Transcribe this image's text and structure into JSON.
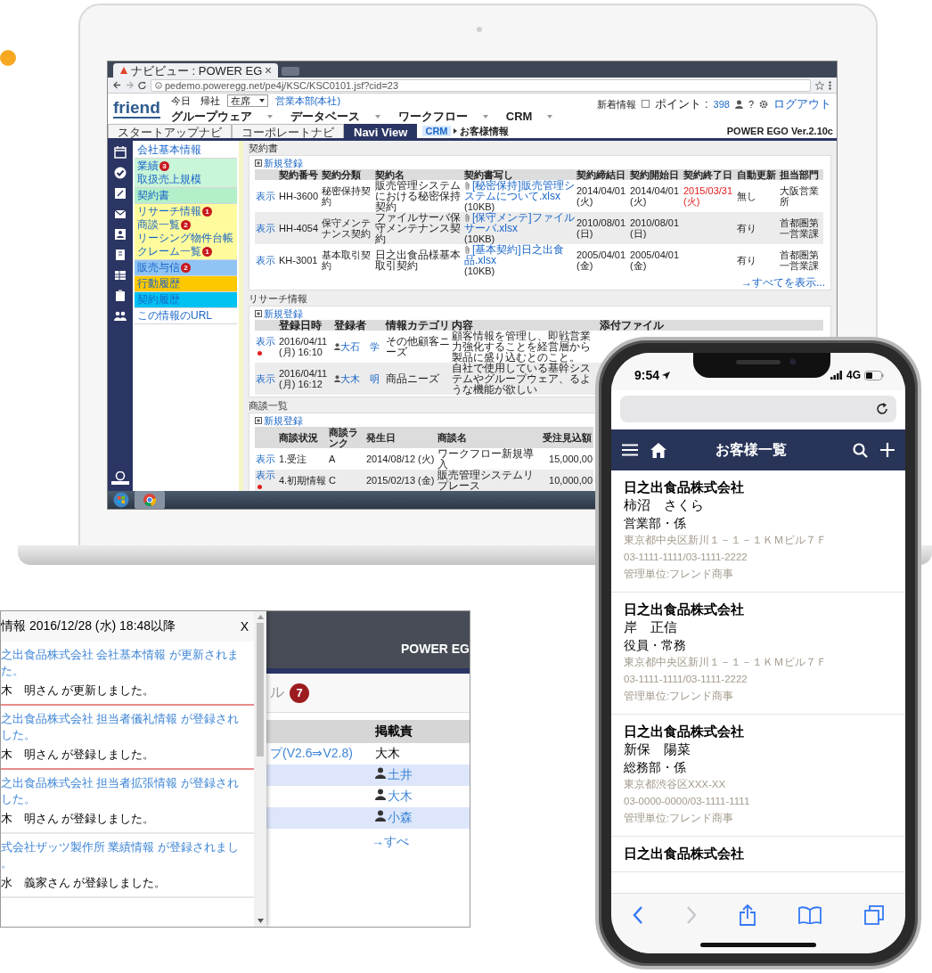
{
  "laptop": {
    "browser_tab": {
      "label": "ナビビュー : POWER EG"
    },
    "url": "pedemo.poweregg.net/pe4j/KSC/KSC0101.jsf?cid=23",
    "app_header": {
      "logo": "friend",
      "presence_label": "今日　帰社",
      "presence_select": "在席",
      "department": "営業本部(本社)",
      "menus": [
        "グループウェア",
        "データベース",
        "ワークフロー",
        "CRM"
      ],
      "news": "新着情報",
      "news_checked": false,
      "points_label": "ポイント :",
      "points": "398",
      "help": "?",
      "logout": "ログアウト"
    },
    "nav_tabs": [
      {
        "label": "スタートアップナビ",
        "selected": false
      },
      {
        "label": "コーポレートナビ",
        "selected": false
      },
      {
        "label": "Navi View",
        "selected": true
      }
    ],
    "breadcrumb": {
      "root": "CRM",
      "current": "お客様情報"
    },
    "version": "POWER EGO Ver.2.10c",
    "side_menu": [
      {
        "color": "#ffffff",
        "items": [
          {
            "label": "会社基本情報"
          }
        ]
      },
      {
        "color": "#c9f5d8",
        "items": [
          {
            "label": "業績",
            "badge": "3"
          },
          {
            "label": "取扱売上規模"
          }
        ]
      },
      {
        "color": "#b3efc9",
        "items": [
          {
            "label": "契約書"
          }
        ]
      },
      {
        "color": "#fdfb9c",
        "items": [
          {
            "label": "リサーチ情報",
            "badge": "1"
          },
          {
            "label": "商談一覧",
            "badge": "2"
          },
          {
            "label": "リーシング物件台帳"
          },
          {
            "label": "クレーム一覧",
            "badge": "1"
          }
        ]
      },
      {
        "color": "#8fc4f4",
        "items": [
          {
            "label": "販売与信",
            "badge": "2"
          }
        ]
      },
      {
        "color": "#fcc800",
        "items": [
          {
            "label": "行動履歴"
          }
        ]
      },
      {
        "color": "#00c2f3",
        "items": [
          {
            "label": "契約履歴"
          }
        ]
      },
      {
        "color": "#ffffff",
        "items": [
          {
            "label": "この情報のURL"
          }
        ]
      }
    ],
    "contracts": {
      "title": "契約書",
      "add_link": "新規登録",
      "columns": [
        "契約番号",
        "契約分類",
        "契約名",
        "契約書写し",
        "契約締結日",
        "契約開始日",
        "契約終了日",
        "自動更新",
        "担当部門"
      ],
      "rows": [
        {
          "view": "表示",
          "number": "HH-3600",
          "category": "秘密保持契約",
          "name": "販売管理システムにおける秘密保持契約",
          "file": "[秘密保持]販売管理システムについて.xlsx",
          "size": "(10KB)",
          "signed": "2014/04/01 (火)",
          "start": "2014/04/01 (火)",
          "end": "2015/03/31 (火)",
          "end_alert": true,
          "auto_renew": "無し",
          "dept": "大阪営業所"
        },
        {
          "view": "表示",
          "number": "HH-4054",
          "category": "保守メンテナンス契約",
          "name": "ファイルサーバ保守メンテナンス契約",
          "file": "[保守メンテ]ファイルサーバ.xlsx",
          "size": "(10KB)",
          "signed": "2010/08/01 (日)",
          "start": "2010/08/01 (日)",
          "auto_renew": "有り",
          "dept": "首都圏第一営業課"
        },
        {
          "view": "表示",
          "number": "KH-3001",
          "category": "基本取引契約",
          "name": "日之出食品様基本取引契約",
          "file": "[基本契約]日之出食品.xlsx",
          "size": "(10KB)",
          "signed": "2005/04/01 (金)",
          "start": "2005/04/01 (金)",
          "auto_renew": "有り",
          "dept": "首都圏第一営業課"
        }
      ],
      "more": "→すべてを表示..."
    },
    "research": {
      "title": "リサーチ情報",
      "add_link": "新規登録",
      "columns": [
        "登録日時",
        "登録者",
        "情報カテゴリ",
        "内容",
        "添付ファイル"
      ],
      "rows": [
        {
          "view": "表示",
          "new": true,
          "date": "2016/04/11 (月) 16:10",
          "user": "大石　学",
          "category": "その他顧客ニーズ",
          "content": "顧客情報を管理し、即戦営業力強化することを経営層から製品に盛り込むとのこと。"
        },
        {
          "view": "表示",
          "new": false,
          "date": "2016/04/11 (月) 16:12",
          "user": "大木　明",
          "category": "商品ニーズ",
          "content": "自社で使用している基幹システムやグループウェア、るような機能が欲しい"
        }
      ]
    },
    "deals": {
      "title": "商談一覧",
      "add_link": "新規登録",
      "columns": [
        "商談状況",
        "商談ランク",
        "発生日",
        "商談名",
        "受注見込額"
      ],
      "rows": [
        {
          "view": "表示",
          "new": false,
          "status": "1.受注",
          "rank": "A",
          "date": "2014/08/12 (火)",
          "name": "ワークフロー新規導入",
          "amount": "15,000,00"
        },
        {
          "view": "表示",
          "new": true,
          "status": "4.初期情報",
          "rank": "C",
          "date": "2015/02/13 (金)",
          "name": "販売管理システムリプレース",
          "amount": "10,000,00"
        }
      ]
    }
  },
  "notice_popup": {
    "title": "情報 2016/12/28 (水) 18:48以降",
    "close": "X",
    "entries": [
      {
        "new": true,
        "link_lines": [
          "之出食品株式会社 会社基本情報 が更新されま",
          "た。"
        ],
        "note": "木　明さん が更新しました。"
      },
      {
        "new": true,
        "link_lines": [
          "之出食品株式会社 担当者儀礼情報 が登録され",
          "した。"
        ],
        "note": "木　明さん が登録しました。"
      },
      {
        "new": false,
        "link_lines": [
          "之出食品株式会社 担当者拡張情報 が登録され",
          "した。"
        ],
        "note": "木　明さん が登録しました。"
      },
      {
        "new": false,
        "link_lines": [
          "式会社ザッツ製作所 業績情報 が登録されまし",
          "。"
        ],
        "note": "水　義家さん が登録しました。"
      }
    ],
    "background_app": {
      "brand": "POWER EG",
      "tab_label": "ル",
      "badge": "7",
      "column": "掲載責",
      "rows": [
        {
          "title": "プ(V2.6⇒V2.8)",
          "person": "大木",
          "person_link": false,
          "highlighted": false
        },
        {
          "person": "土井",
          "person_link": true,
          "highlighted": true
        },
        {
          "person": "大木",
          "person_link": true,
          "highlighted": false
        },
        {
          "person": "小森",
          "person_link": true,
          "highlighted": true
        }
      ],
      "more": "→すべ"
    }
  },
  "phone": {
    "time": "9:54",
    "network": "4G",
    "title": "お客様一覧",
    "customers": [
      {
        "company": "日之出食品株式会社",
        "name": "柿沼　さくら",
        "dept": "営業部・係",
        "address": "東京都中央区新川１－１－１ＫＭビル７Ｆ",
        "phone": "03-1111-1111/03-1111-2222",
        "unit": "管理単位:フレンド商事"
      },
      {
        "company": "日之出食品株式会社",
        "name": "岸　正信",
        "dept": "役員・常務",
        "address": "東京都中央区新川１－１－１ＫＭビル７Ｆ",
        "phone": "03-1111-1111/03-1111-2222",
        "unit": "管理単位:フレンド商事"
      },
      {
        "company": "日之出食品株式会社",
        "name": "新保　陽菜",
        "dept": "総務部・係",
        "address": "東京都渋谷区XXX-XX",
        "phone": "03-0000-0000/03-1111-1111",
        "unit": "管理単位:フレンド商事"
      },
      {
        "company": "日之出食品株式会社"
      }
    ]
  }
}
